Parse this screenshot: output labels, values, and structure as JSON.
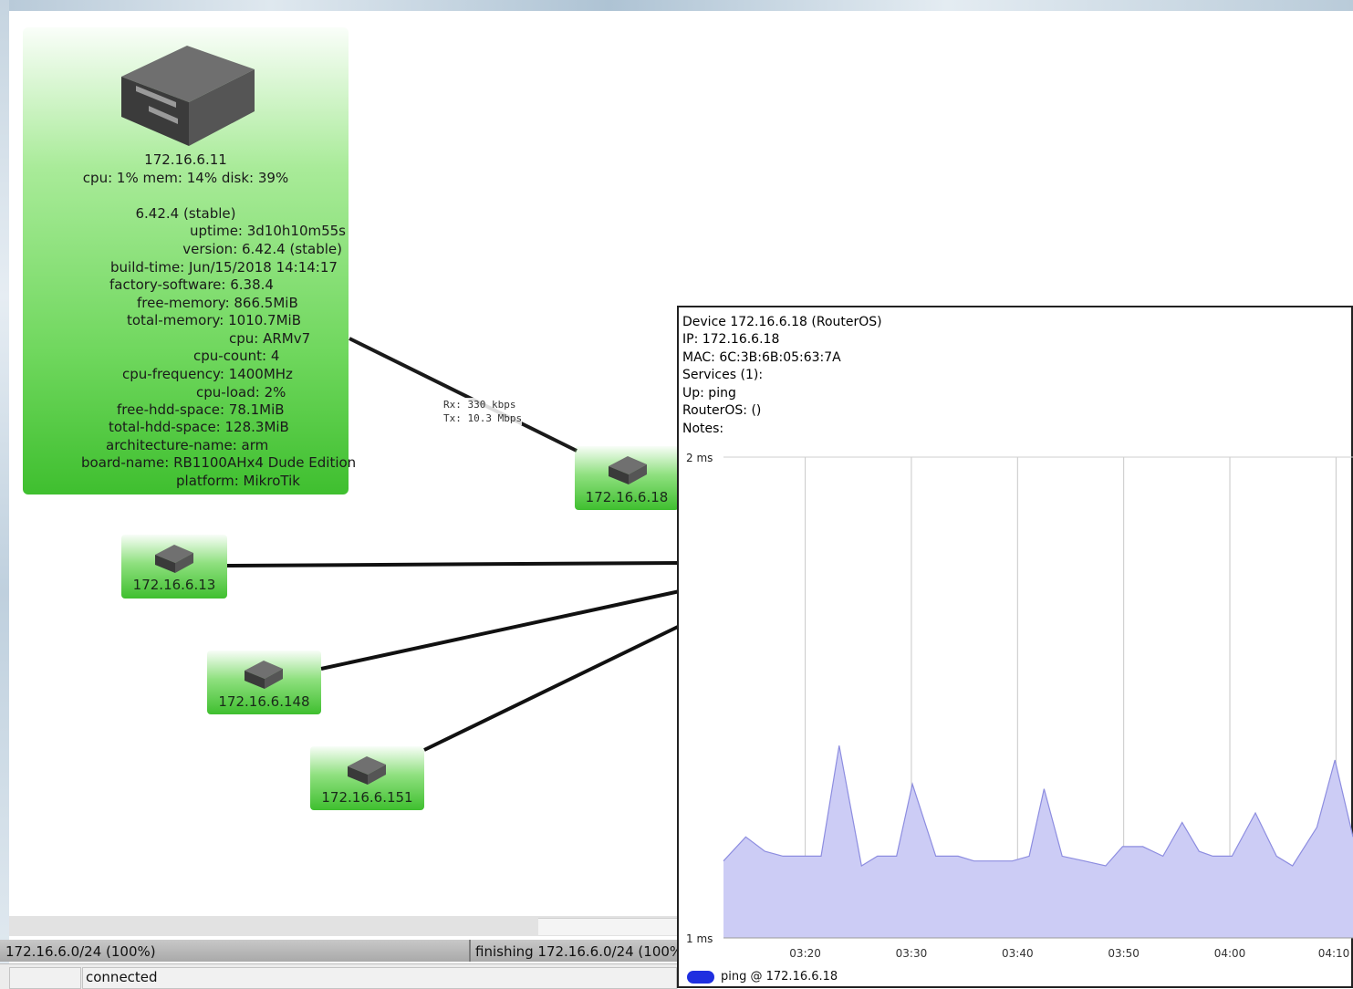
{
  "main_device": {
    "ip": "172.16.6.11",
    "stats": "cpu: 1% mem: 14% disk: 39%",
    "version_header": "6.42.4 (stable)",
    "details": [
      "uptime: 3d10h10m55s",
      "version: 6.42.4 (stable)",
      "build-time: Jun/15/2018 14:14:17",
      "factory-software: 6.38.4",
      "free-memory: 866.5MiB",
      "total-memory: 1010.7MiB",
      "cpu: ARMv7",
      "cpu-count: 4",
      "cpu-frequency: 1400MHz",
      "cpu-load: 2%",
      "free-hdd-space: 78.1MiB",
      "total-hdd-space: 128.3MiB",
      "architecture-name: arm",
      "board-name: RB1100AHx4 Dude Edition",
      "platform: MikroTik"
    ]
  },
  "nodes": {
    "n18": "172.16.6.18",
    "n13": "172.16.6.13",
    "n148": "172.16.6.148",
    "n151": "172.16.6.151"
  },
  "link_label": {
    "rx": "Rx: 330 kbps",
    "tx": "Tx: 10.3 Mbps"
  },
  "progress": {
    "left": "172.16.6.0/24 (100%)",
    "right": "finishing 172.16.6.0/24 (100%"
  },
  "status": {
    "text": "connected"
  },
  "tooltip": {
    "lines": [
      "Device 172.16.6.18 (RouterOS)",
      "IP: 172.16.6.18",
      "MAC: 6C:3B:6B:05:63:7A",
      "Services (1):",
      "Up: ping",
      "RouterOS:  ()",
      "Notes:"
    ],
    "legend": "ping @ 172.16.6.18"
  },
  "colors": {
    "node_green": "#3fbf2f",
    "chart_fill": "#ccccf5",
    "chart_line": "#8d8de0",
    "legend": "#1f2fe0"
  },
  "chart_data": {
    "type": "area",
    "y_labels": [
      "2 ms",
      "1 ms"
    ],
    "ylim": [
      1,
      2
    ],
    "x_ticks": [
      "03:20",
      "03:30",
      "03:40",
      "03:50",
      "04:00",
      "04:10"
    ],
    "x_tick_minutes": [
      200,
      210,
      220,
      230,
      240,
      250
    ],
    "xlim_minutes": [
      192.3,
      251.6
    ],
    "grid": "vertical",
    "series": [
      {
        "name": "ping @ 172.16.6.18",
        "x_minutes": [
          192.3,
          194.4,
          196.2,
          197.9,
          199.7,
          201.5,
          203.2,
          205.3,
          206.8,
          208.6,
          210.1,
          212.3,
          214.4,
          215.9,
          217.4,
          219.5,
          221.1,
          222.5,
          224.2,
          226.3,
          228.3,
          229.9,
          231.8,
          233.7,
          235.5,
          237.1,
          238.4,
          240.2,
          242.4,
          244.4,
          245.9,
          248.2,
          249.9,
          251.6
        ],
        "ping_ms": [
          1.16,
          1.21,
          1.18,
          1.17,
          1.17,
          1.17,
          1.4,
          1.15,
          1.17,
          1.17,
          1.32,
          1.17,
          1.17,
          1.16,
          1.16,
          1.16,
          1.17,
          1.31,
          1.17,
          1.16,
          1.15,
          1.19,
          1.19,
          1.17,
          1.24,
          1.18,
          1.17,
          1.17,
          1.26,
          1.17,
          1.15,
          1.23,
          1.37,
          1.21
        ]
      }
    ]
  }
}
